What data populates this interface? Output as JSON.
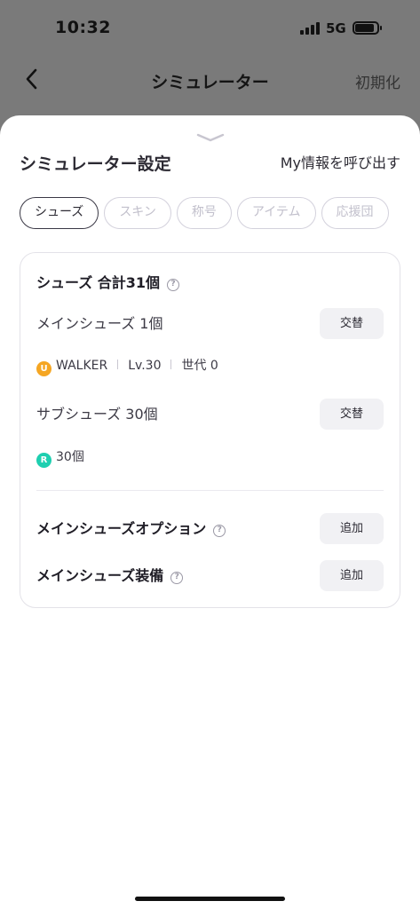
{
  "status_bar": {
    "time": "10:32",
    "network": "5G"
  },
  "nav": {
    "title": "シミュレーター",
    "reset_label": "初期化"
  },
  "sheet": {
    "title": "シミュレーター設定",
    "load_label": "My情報を呼び出す",
    "tabs": [
      {
        "label": "シューズ",
        "active": true
      },
      {
        "label": "スキン",
        "active": false
      },
      {
        "label": "称号",
        "active": false
      },
      {
        "label": "アイテム",
        "active": false
      },
      {
        "label": "応援団",
        "active": false
      }
    ]
  },
  "shoes": {
    "heading": "シューズ 合計31個",
    "main": {
      "label": "メインシューズ 1個",
      "button": "交替",
      "rarity": "U",
      "rarity_color": "#f5a623",
      "name": "WALKER",
      "level": "Lv.30",
      "generation": "世代 0"
    },
    "sub": {
      "label": "サブシューズ 30個",
      "button": "交替",
      "rarity": "R",
      "rarity_color": "#1ecfb0",
      "count": "30個"
    },
    "option": {
      "label": "メインシューズオプション",
      "button": "追加"
    },
    "equipment": {
      "label": "メインシューズ装備",
      "button": "追加"
    }
  },
  "icons": {
    "back": "chevron-left-icon",
    "help": "question-circle-icon",
    "handle": "chevron-down-icon"
  }
}
